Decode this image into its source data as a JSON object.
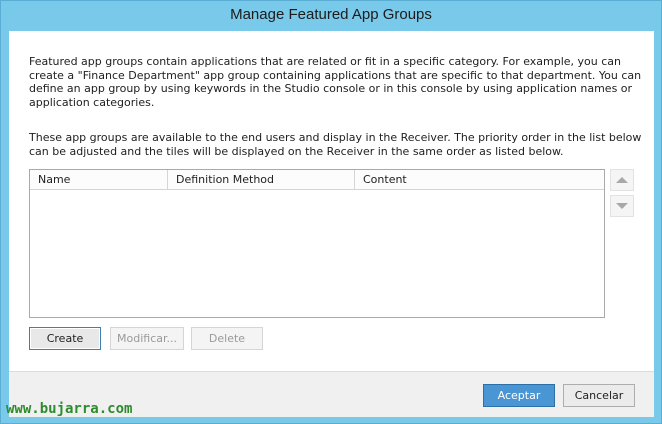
{
  "window": {
    "title": "Manage Featured App Groups"
  },
  "main": {
    "description1": "Featured app groups contain applications that are related or fit in a specific category. For example, you can create a \"Finance Department\" app group containing applications that are specific to that department. You can define an app group by using keywords in the Studio console or in this console by using application names or application categories.",
    "description2": "These app groups are available to the end users and display in the Receiver. The priority order in the list below can be adjusted and the tiles will be displayed on the Receiver in the same order as listed below.",
    "table": {
      "columns": [
        "Name",
        "Definition Method",
        "Content"
      ],
      "rows": []
    },
    "buttons": {
      "create": "Create",
      "modify": "Modificar...",
      "delete": "Delete"
    }
  },
  "footer": {
    "accept": "Aceptar",
    "cancel": "Cancelar"
  },
  "watermark": "www.bujarra.com",
  "colors": {
    "chrome": "#79c9ea",
    "accent": "#4a95d3"
  }
}
